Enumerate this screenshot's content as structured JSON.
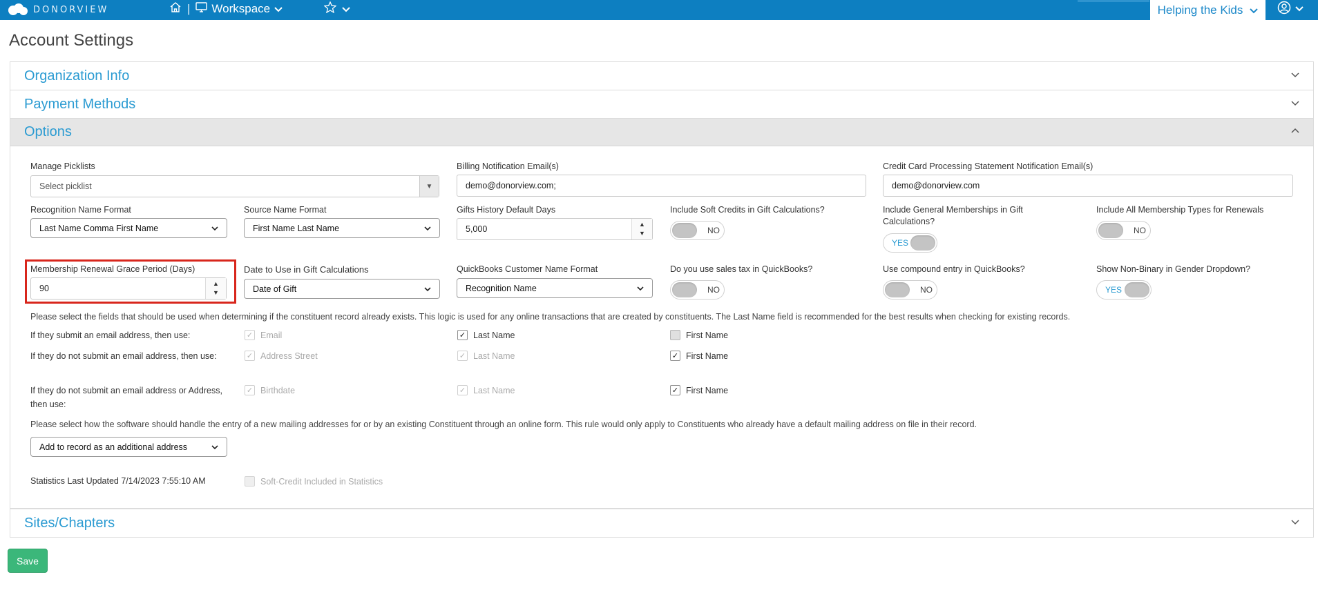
{
  "topbar": {
    "logo_text": "DONORVIEW",
    "workspace_label": "Workspace",
    "org_label": "Helping the Kids"
  },
  "page": {
    "title": "Account Settings"
  },
  "sections": {
    "org_info": "Organization Info",
    "payment_methods": "Payment Methods",
    "options": "Options",
    "sites": "Sites/Chapters"
  },
  "options": {
    "manage_picklists": {
      "label": "Manage Picklists",
      "placeholder": "Select picklist"
    },
    "billing_email": {
      "label": "Billing Notification Email(s)",
      "value": "demo@donorview.com;"
    },
    "cc_email": {
      "label": "Credit Card Processing Statement Notification Email(s)",
      "value": "demo@donorview.com"
    },
    "recognition_format": {
      "label": "Recognition Name Format",
      "value": "Last Name Comma First Name"
    },
    "source_format": {
      "label": "Source Name Format",
      "value": "First Name Last Name"
    },
    "gifts_history": {
      "label": "Gifts History Default Days",
      "value": "5,000"
    },
    "soft_credits": {
      "label": "Include Soft Credits in Gift Calculations?",
      "state": "NO"
    },
    "general_memberships": {
      "label": "Include General Memberships in Gift Calculations?",
      "state": "YES"
    },
    "all_membership_types": {
      "label": "Include All Membership Types for Renewals",
      "state": "NO"
    },
    "grace_period": {
      "label": "Membership Renewal Grace Period (Days)",
      "value": "90"
    },
    "date_to_use": {
      "label": "Date to Use in Gift Calculations",
      "value": "Date of Gift"
    },
    "qb_name_format": {
      "label": "QuickBooks Customer Name Format",
      "value": "Recognition Name"
    },
    "qb_sales_tax": {
      "label": "Do you use sales tax in QuickBooks?",
      "state": "NO"
    },
    "qb_compound": {
      "label": "Use compound entry in QuickBooks?",
      "state": "NO"
    },
    "non_binary": {
      "label": "Show Non-Binary in Gender Dropdown?",
      "state": "YES"
    },
    "match_note": "Please select the fields that should be used when determining if the constituent record already exists. This logic is used for any online transactions that are created by constituents. The Last Name field is recommended for the best results when checking for existing records.",
    "match_rows": [
      {
        "label": "If they submit an email address, then use:",
        "c1": "Email",
        "c2": "Last Name",
        "c3": "First Name"
      },
      {
        "label": "If they do not submit an email address, then use:",
        "c1": "Address Street",
        "c2": "Last Name",
        "c3": "First Name"
      },
      {
        "label": "If they do not submit an email address or Address, then use:",
        "c1": "Birthdate",
        "c2": "Last Name",
        "c3": "First Name"
      }
    ],
    "address_note": "Please select how the software should handle the entry of a new mailing addresses for or by an existing Constituent through an online form. This rule would only apply to Constituents who already have a default mailing address on file in their record.",
    "address_rule": "Add to record as an additional address",
    "stats_updated": "Statistics Last Updated 7/14/2023 7:55:10 AM",
    "soft_credit_stats": "Soft-Credit Included in Statistics"
  },
  "save_label": "Save",
  "colors": {
    "topbar": "#0d7fc1",
    "link": "#2b9bd2",
    "save": "#3bb77a",
    "highlight": "#d8261c"
  }
}
